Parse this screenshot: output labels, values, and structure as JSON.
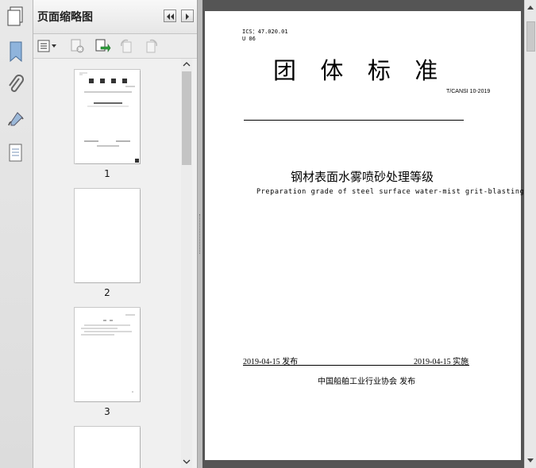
{
  "panel": {
    "title": "页面缩略图"
  },
  "thumbnails": [
    {
      "number": "1"
    },
    {
      "number": "2"
    },
    {
      "number": "3"
    }
  ],
  "page": {
    "ics": "ICS：47.020.01",
    "category": "U 06",
    "heading": "团  体  标  准",
    "code": "T/CANSI 10-2019",
    "title_cn": "钢材表面水雾喷砂处理等级",
    "title_en": "Preparation grade of steel surface water-mist grit-blasting",
    "publish_date": "2019-04-15 发布",
    "implement_date": "2019-04-15 实施",
    "publisher": "中国船舶工业行业协会  发布"
  }
}
